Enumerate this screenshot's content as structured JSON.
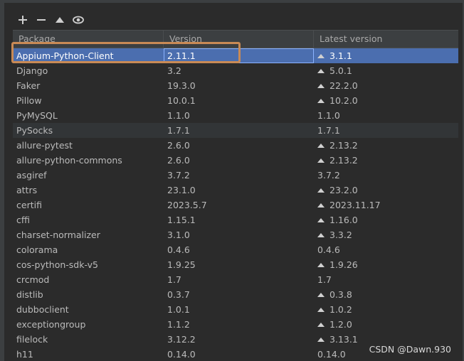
{
  "toolbar": {
    "add_icon": "plus-icon",
    "remove_icon": "minus-icon",
    "upgrade_icon": "triangle-up-icon",
    "show_icon": "eye-icon"
  },
  "table": {
    "headers": [
      "Package",
      "Version",
      "Latest version"
    ],
    "rows": [
      {
        "package": "Appium-Python-Client",
        "version": "2.11.1",
        "latest": "3.1.1",
        "upgrade": true
      },
      {
        "package": "Django",
        "version": "3.2",
        "latest": "5.0.1",
        "upgrade": true
      },
      {
        "package": "Faker",
        "version": "19.3.0",
        "latest": "22.2.0",
        "upgrade": true
      },
      {
        "package": "Pillow",
        "version": "10.0.1",
        "latest": "10.2.0",
        "upgrade": true
      },
      {
        "package": "PyMySQL",
        "version": "1.1.0",
        "latest": "1.1.0",
        "upgrade": false
      },
      {
        "package": "PySocks",
        "version": "1.7.1",
        "latest": "1.7.1",
        "upgrade": false
      },
      {
        "package": "allure-pytest",
        "version": "2.6.0",
        "latest": "2.13.2",
        "upgrade": true
      },
      {
        "package": "allure-python-commons",
        "version": "2.6.0",
        "latest": "2.13.2",
        "upgrade": true
      },
      {
        "package": "asgiref",
        "version": "3.7.2",
        "latest": "3.7.2",
        "upgrade": false
      },
      {
        "package": "attrs",
        "version": "23.1.0",
        "latest": "23.2.0",
        "upgrade": true
      },
      {
        "package": "certifi",
        "version": "2023.5.7",
        "latest": "2023.11.17",
        "upgrade": true
      },
      {
        "package": "cffi",
        "version": "1.15.1",
        "latest": "1.16.0",
        "upgrade": true
      },
      {
        "package": "charset-normalizer",
        "version": "3.1.0",
        "latest": "3.3.2",
        "upgrade": true
      },
      {
        "package": "colorama",
        "version": "0.4.6",
        "latest": "0.4.6",
        "upgrade": false
      },
      {
        "package": "cos-python-sdk-v5",
        "version": "1.9.25",
        "latest": "1.9.26",
        "upgrade": true
      },
      {
        "package": "crcmod",
        "version": "1.7",
        "latest": "1.7",
        "upgrade": false
      },
      {
        "package": "distlib",
        "version": "0.3.7",
        "latest": "0.3.8",
        "upgrade": true
      },
      {
        "package": "dubboclient",
        "version": "1.0.1",
        "latest": "1.0.2",
        "upgrade": true
      },
      {
        "package": "exceptiongroup",
        "version": "1.1.2",
        "latest": "1.2.0",
        "upgrade": true
      },
      {
        "package": "filelock",
        "version": "3.12.2",
        "latest": "3.13.1",
        "upgrade": true
      },
      {
        "package": "h11",
        "version": "0.14.0",
        "latest": "0.14.0",
        "upgrade": false
      }
    ]
  },
  "watermark": "CSDN @Dawn.930",
  "colors": {
    "selection": "#4b6eaf",
    "annotation_box": "#c98a55"
  }
}
